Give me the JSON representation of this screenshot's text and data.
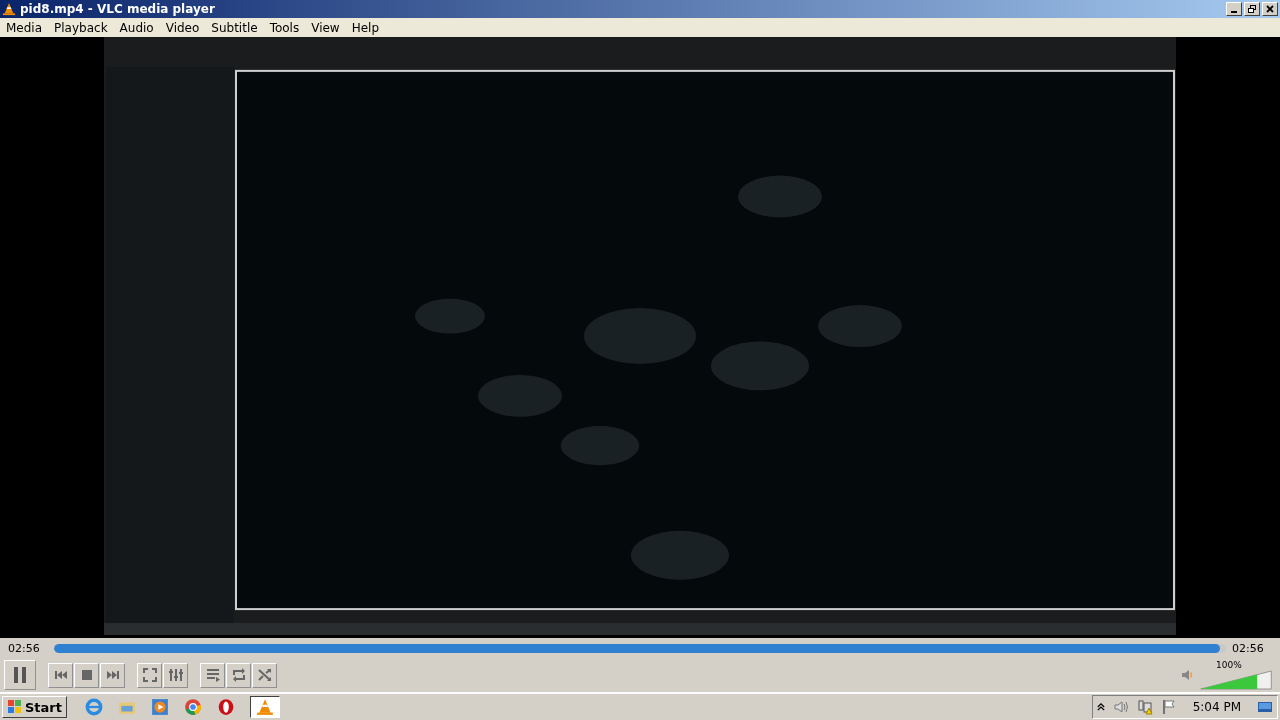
{
  "window": {
    "title": "pid8.mp4 - VLC media player"
  },
  "menu": [
    "Media",
    "Playback",
    "Audio",
    "Video",
    "Subtitle",
    "Tools",
    "View",
    "Help"
  ],
  "seek": {
    "elapsed": "02:56",
    "total": "02:56",
    "level": 0.995
  },
  "player": {
    "playing": true
  },
  "volume": {
    "reading": "100%",
    "level": 0.8
  },
  "taskbar": {
    "start": "Start",
    "clock": "5:04 PM"
  }
}
